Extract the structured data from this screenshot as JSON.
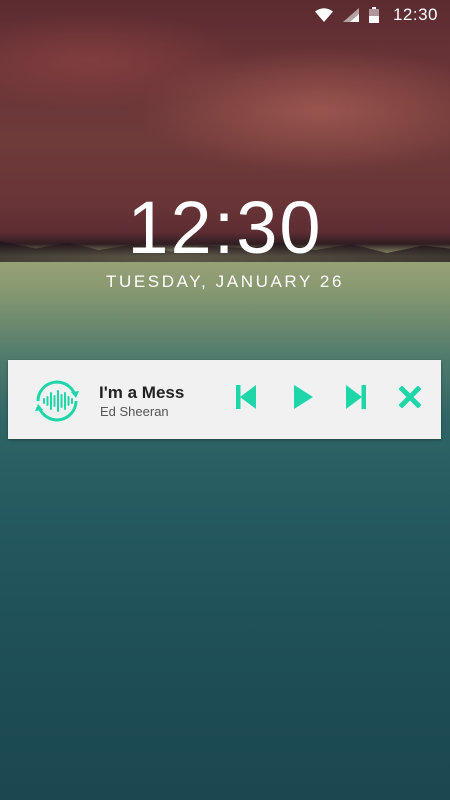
{
  "status_bar": {
    "time": "12:30"
  },
  "lockscreen": {
    "time": "12:30",
    "date": "TUESDAY, JANUARY 26"
  },
  "notification": {
    "title": "I'm a Mess",
    "artist": "Ed Sheeran"
  },
  "colors": {
    "accent": "#1fd6a8",
    "card_bg": "#f1f1f1"
  },
  "icons": [
    "wifi-icon",
    "signal-icon",
    "battery-icon",
    "music-waveform-icon",
    "previous-icon",
    "play-icon",
    "next-icon",
    "close-icon"
  ]
}
